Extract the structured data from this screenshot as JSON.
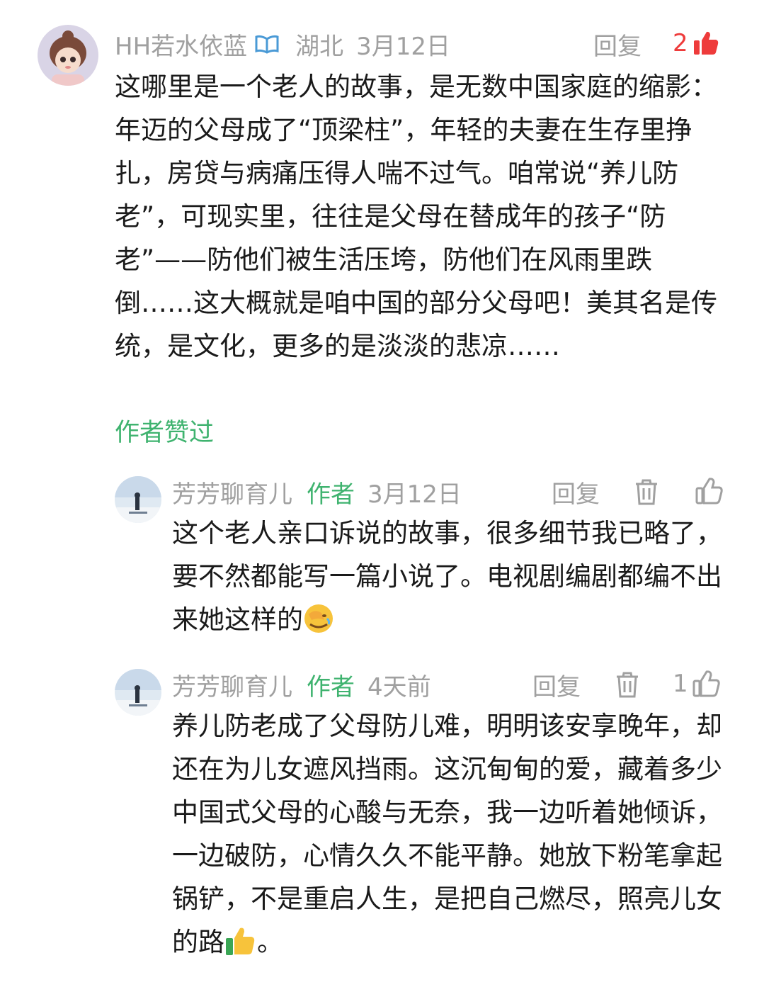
{
  "comments": [
    {
      "user": "HH若水依蓝",
      "location": "湖北",
      "date": "3月12日",
      "reply_label": "回复",
      "like_count": "2",
      "text": "这哪里是一个老人的故事，是无数中国家庭的缩影：年迈的父母成了“顶梁柱”，年轻的夫妻在生存里挣扎，房贷与病痛压得人喘不过气。咱常说“养儿防老”，可现实里，往往是父母在替成年的孩子“防老”——防他们被生活压垮，防他们在风雨里跌倒……这大概就是咱中国的部分父母吧！美其名是传统，是文化，更多的是淡淡的悲凉……",
      "liked_by_author": "作者赞过",
      "accent_color": "#ee3b3b"
    }
  ],
  "replies": [
    {
      "user": "芳芳聊育儿",
      "role": "作者",
      "date": "3月12日",
      "reply_label": "回复",
      "like_count": "",
      "text": "这个老人亲口诉说的故事，很多细节我已略了，要不然都能写一篇小说了。电视剧编剧都编不出来她这样的",
      "emoji": "facepalm"
    },
    {
      "user": "芳芳聊育儿",
      "role": "作者",
      "date": "4天前",
      "reply_label": "回复",
      "like_count": "1",
      "text": "养儿防老成了父母防儿难，明明该安享晚年，却还在为儿女遮风挡雨。这沉甸甸的爱，藏着多少中国式父母的心酸与无奈，我一边听着她倾诉，一边破防，心情久久不能平静。她放下粉笔拿起锅铲，不是重启人生，是把自己燃尽，照亮儿女的路",
      "text_tail": "。",
      "emoji": "thumbs-up"
    }
  ],
  "colors": {
    "author_green": "#3fb36f",
    "meta_gray": "#a0a0a0",
    "like_red": "#ee3b3b"
  }
}
